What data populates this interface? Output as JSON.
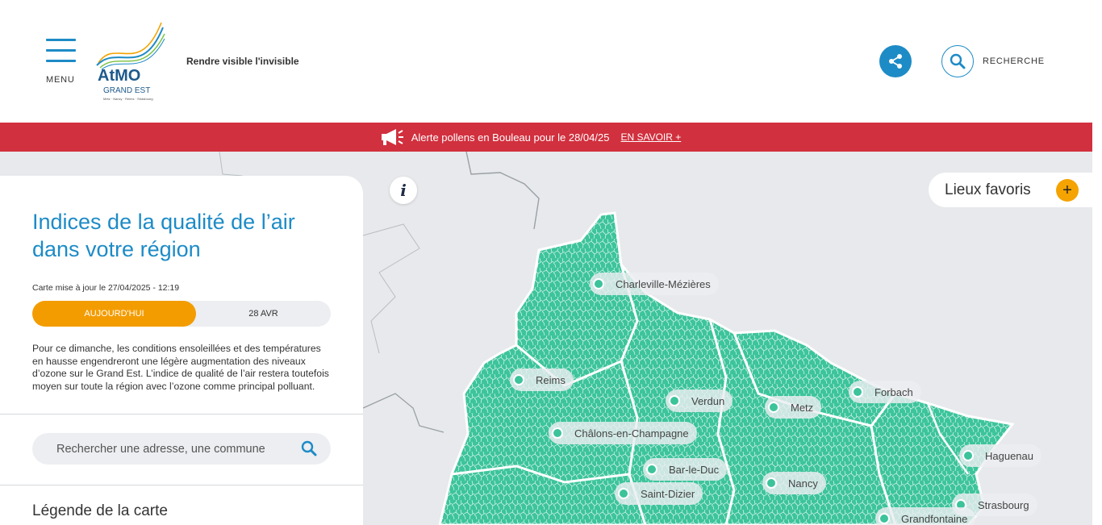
{
  "header": {
    "menu_label": "MENU",
    "logo_text": "AtMO",
    "logo_sub": "GRAND EST",
    "logo_cities": "Metz · Nancy · Reims · Strasbourg",
    "tagline": "Rendre visible l'invisible",
    "search_label": "RECHERCHE"
  },
  "alert": {
    "text": "Alerte pollens en Bouleau pour le 28/04/25",
    "link": "EN SAVOIR +"
  },
  "panel": {
    "title": "Indices de la qualité de l’air dans votre région",
    "updated": "Carte mise à jour le 27/04/2025 - 12:19",
    "tabs": {
      "today": "AUJOURD'HUI",
      "tomorrow": "28 AVR"
    },
    "forecast": "Pour ce dimanche, les conditions ensoleillées et des températures en hausse engendreront une légère augmentation des niveaux d’ozone sur le Grand Est. L’indice de qualité de l’air restera toutefois moyen sur toute la région avec l’ozone comme principal polluant.",
    "search_placeholder": "Rechercher une adresse, une commune",
    "legend_title": "Légende de la carte"
  },
  "map": {
    "favorites_label": "Lieux favoris",
    "favorites_add": "+",
    "info_glyph": "i",
    "cities": [
      "Charleville-Mézières",
      "Reims",
      "Verdun",
      "Metz",
      "Forbach",
      "Châlons-en-Champagne",
      "Bar-le-Duc",
      "Haguenau",
      "Nancy",
      "Saint-Dizier",
      "Strasbourg",
      "Grandfontaine"
    ]
  },
  "colors": {
    "brand_blue": "#1d8bc6",
    "alert_red": "#d1303e",
    "active_orange": "#f39c00",
    "air_quality_good": "#3cc39a"
  },
  "icons": [
    "hamburger-menu-icon",
    "share-icon",
    "search-icon",
    "megaphone-icon",
    "info-icon"
  ]
}
